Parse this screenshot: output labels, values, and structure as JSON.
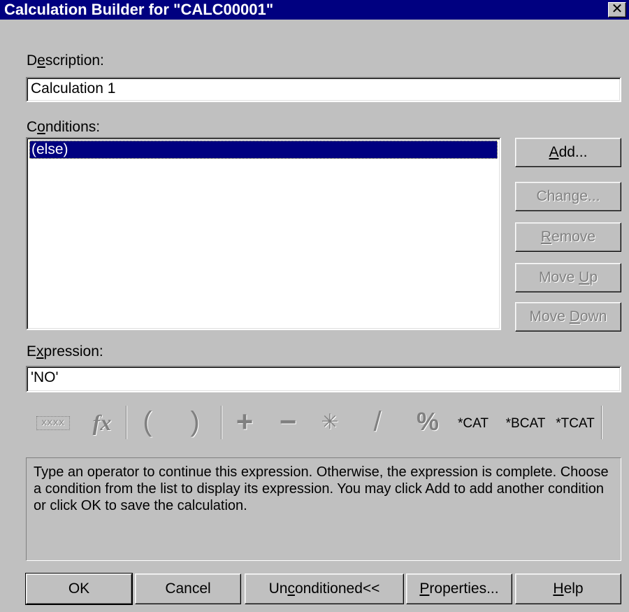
{
  "window": {
    "title": "Calculation Builder for \"CALC00001\"",
    "close_glyph": "✕"
  },
  "description": {
    "label_pre": "D",
    "label_ul": "e",
    "label_post": "scription:",
    "value": "Calculation 1"
  },
  "conditions": {
    "label_pre": "C",
    "label_ul": "o",
    "label_post": "nditions:",
    "items": [
      "(else)"
    ],
    "selected_index": 0
  },
  "side_buttons": {
    "add": {
      "pre": "",
      "ul": "A",
      "post": "dd..."
    },
    "change": {
      "pre": "Chan",
      "ul": "g",
      "post": "e..."
    },
    "remove": {
      "pre": "",
      "ul": "R",
      "post": "emove"
    },
    "move_up": {
      "pre": "Move ",
      "ul": "U",
      "post": "p"
    },
    "move_down": {
      "pre": "Move ",
      "ul": "D",
      "post": "own"
    }
  },
  "expression": {
    "label_pre": "E",
    "label_ul": "x",
    "label_post": "pression:",
    "value": "'NO'"
  },
  "toolbar": {
    "field_glyph": "XXXX",
    "function_glyph": "fx",
    "open_paren": "(",
    "close_paren": ")",
    "plus": "+",
    "minus": "−",
    "multiply": "✳",
    "divide": "/",
    "percent": "%",
    "cat": "*CAT",
    "bcat": "*BCAT",
    "tcat": "*TCAT"
  },
  "help_text": "Type an operator to continue this expression.  Otherwise, the expression is complete. Choose a condition from the list to display its expression.  You may click Add to add another condition or click OK to save the calculation.",
  "bottom_buttons": {
    "ok": {
      "pre": "OK",
      "ul": "",
      "post": ""
    },
    "cancel": {
      "pre": "Cancel",
      "ul": "",
      "post": ""
    },
    "unconditioned": {
      "pre": "Un",
      "ul": "c",
      "post": "onditioned<<"
    },
    "properties": {
      "pre": "",
      "ul": "P",
      "post": "roperties..."
    },
    "help": {
      "pre": "",
      "ul": "H",
      "post": "elp"
    }
  }
}
